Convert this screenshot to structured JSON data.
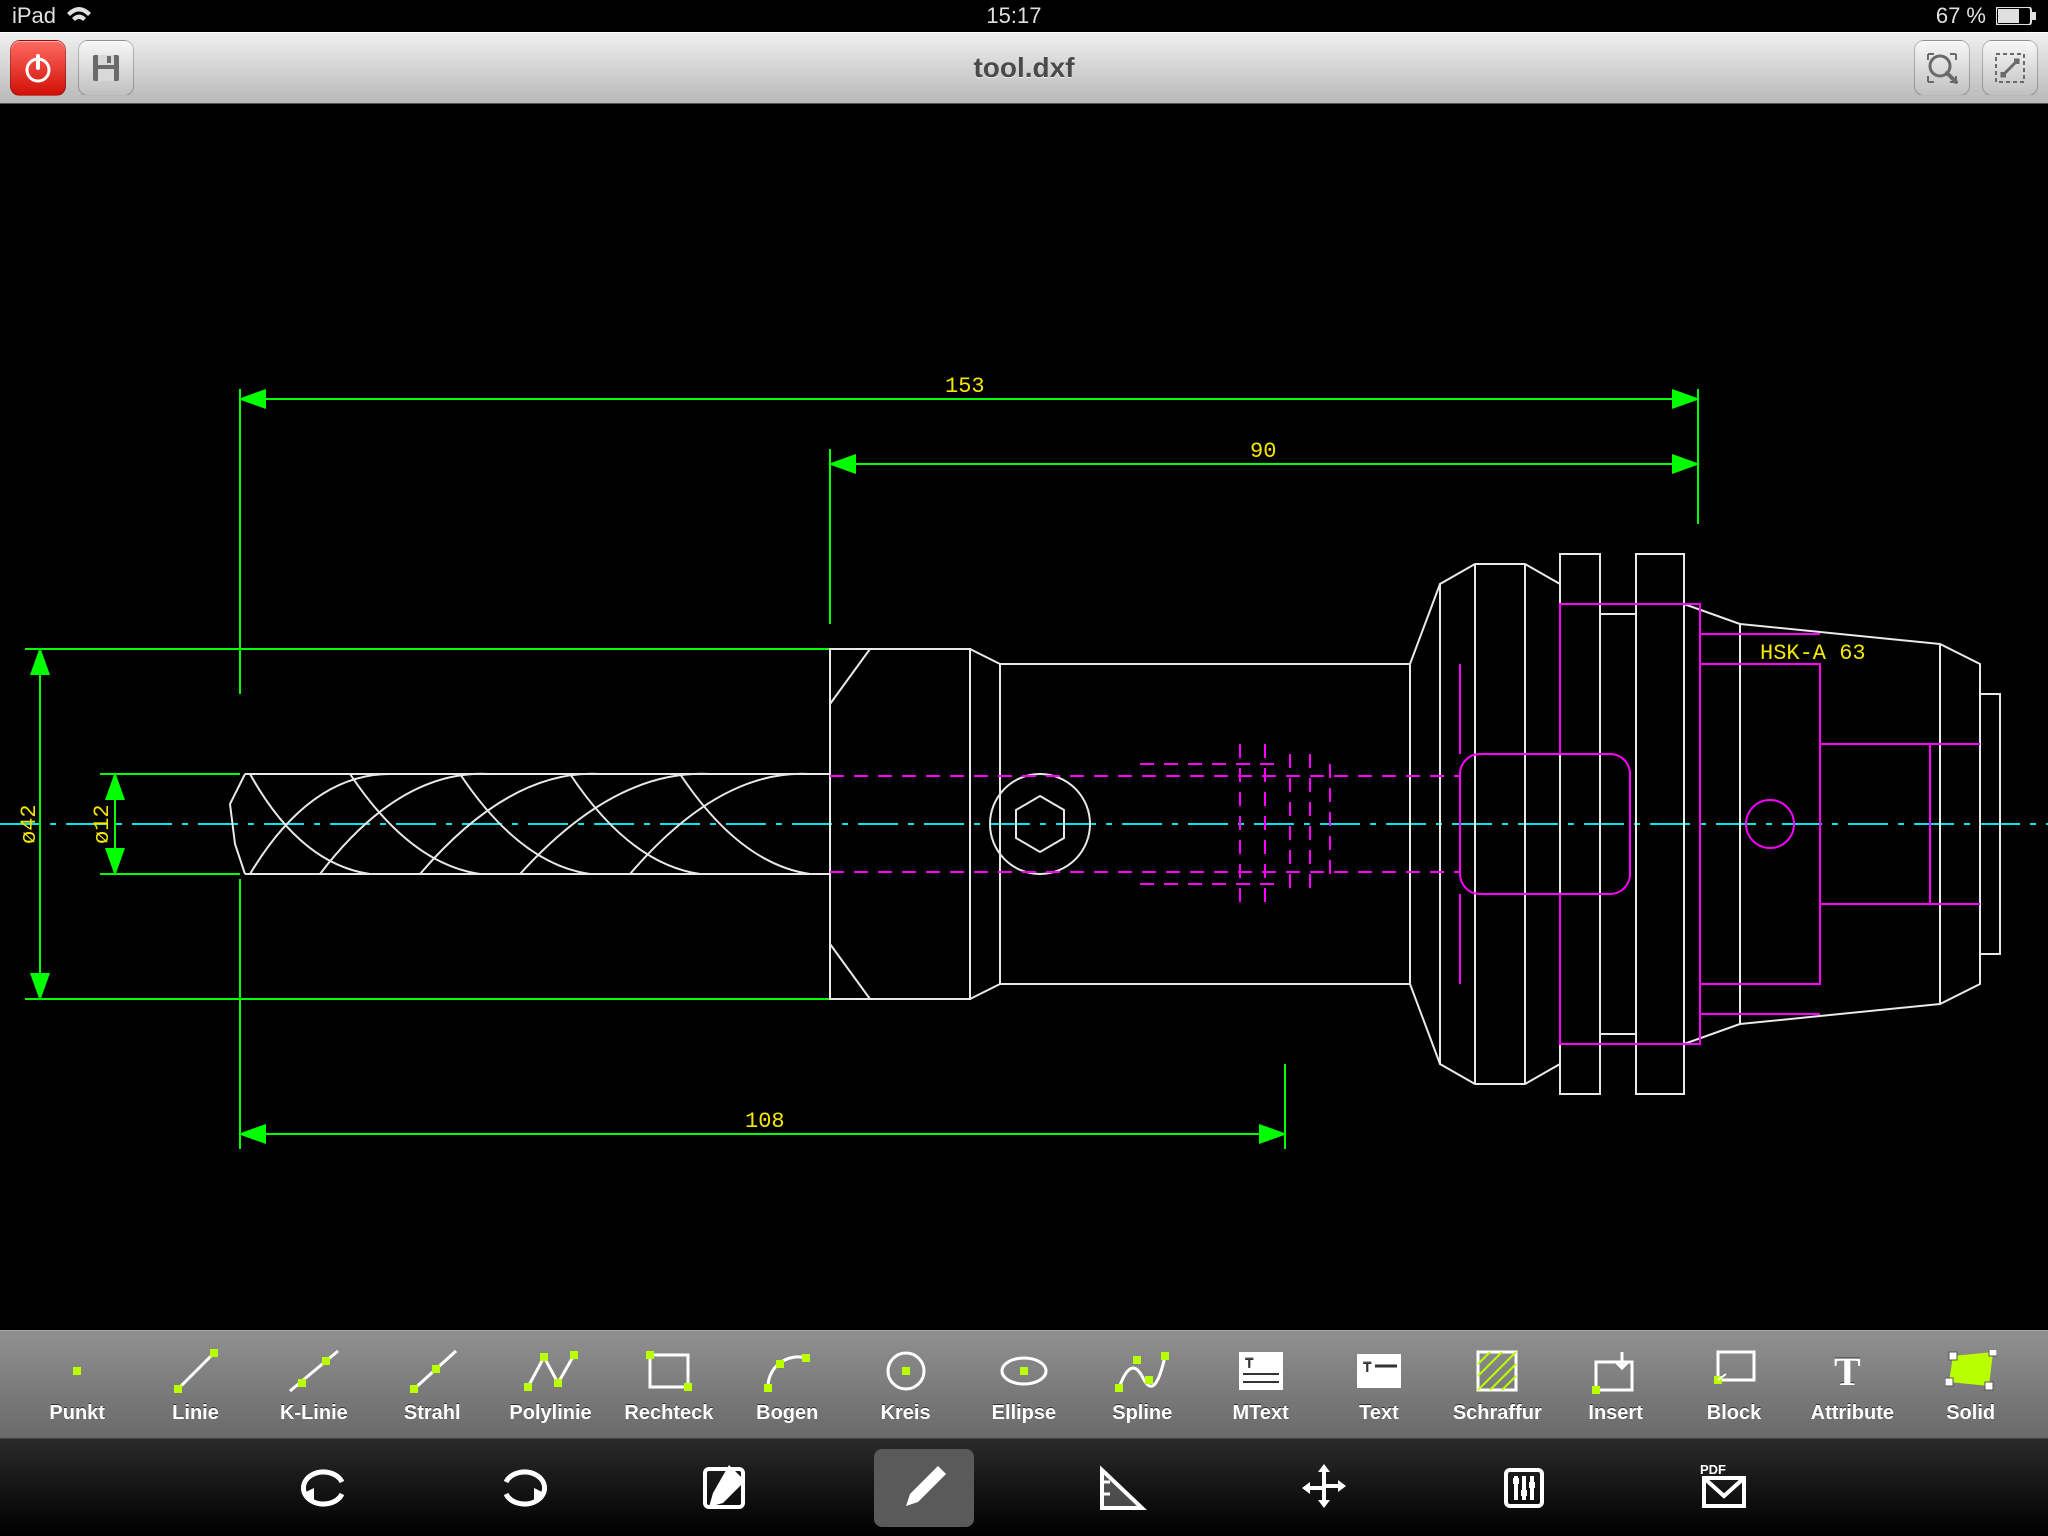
{
  "status": {
    "device": "iPad",
    "time": "15:17",
    "battery": "67 %"
  },
  "titlebar": {
    "filename": "tool.dxf"
  },
  "drawing": {
    "dims": {
      "d153": "153",
      "d90": "90",
      "d108": "108",
      "dia42": "ø42",
      "dia12": "ø12"
    },
    "annotation": "HSK-A 63",
    "colors": {
      "dim": "#00ff00",
      "dimtext": "#f5e800",
      "center": "#00f0f0",
      "hidden": "#ff00ff",
      "geom": "#e8e8e8"
    }
  },
  "tools": [
    {
      "id": "punkt",
      "label": "Punkt"
    },
    {
      "id": "linie",
      "label": "Linie"
    },
    {
      "id": "k-linie",
      "label": "K-Linie"
    },
    {
      "id": "strahl",
      "label": "Strahl"
    },
    {
      "id": "polylinie",
      "label": "Polylinie"
    },
    {
      "id": "rechteck",
      "label": "Rechteck"
    },
    {
      "id": "bogen",
      "label": "Bogen"
    },
    {
      "id": "kreis",
      "label": "Kreis"
    },
    {
      "id": "ellipse",
      "label": "Ellipse"
    },
    {
      "id": "spline",
      "label": "Spline"
    },
    {
      "id": "mtext",
      "label": "MText"
    },
    {
      "id": "text",
      "label": "Text"
    },
    {
      "id": "schraffur",
      "label": "Schraffur"
    },
    {
      "id": "insert",
      "label": "Insert"
    },
    {
      "id": "block",
      "label": "Block"
    },
    {
      "id": "attribute",
      "label": "Attribute"
    },
    {
      "id": "solid",
      "label": "Solid"
    }
  ],
  "actions": [
    {
      "id": "undo"
    },
    {
      "id": "redo"
    },
    {
      "id": "edit"
    },
    {
      "id": "draw",
      "active": true
    },
    {
      "id": "measure"
    },
    {
      "id": "move"
    },
    {
      "id": "settings"
    },
    {
      "id": "export-pdf"
    }
  ]
}
